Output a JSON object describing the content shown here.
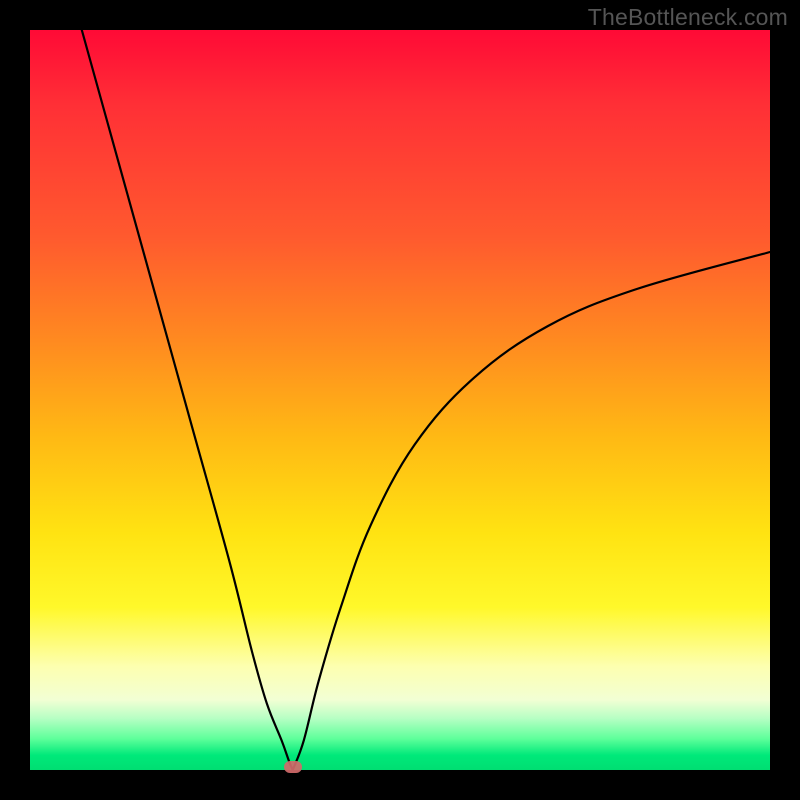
{
  "watermark": "TheBottleneck.com",
  "colors": {
    "curve": "#000000",
    "vertex": "#d16a6a",
    "frame": "#000000"
  },
  "chart_data": {
    "type": "line",
    "title": "",
    "xlabel": "",
    "ylabel": "",
    "xlim": [
      0,
      100
    ],
    "ylim": [
      0,
      100
    ],
    "grid": false,
    "legend": false,
    "series": [
      {
        "name": "left-branch",
        "x": [
          7,
          12,
          17,
          22,
          27,
          30,
          32,
          34,
          35,
          35.5
        ],
        "y": [
          100,
          82,
          64,
          46,
          28,
          16,
          9,
          4,
          1.2,
          0
        ]
      },
      {
        "name": "right-branch",
        "x": [
          35.5,
          37,
          39,
          42,
          46,
          52,
          60,
          70,
          82,
          100
        ],
        "y": [
          0,
          4,
          12,
          22,
          33,
          44,
          53,
          60,
          65,
          70
        ]
      }
    ],
    "vertex": {
      "x": 35.5,
      "y": 0
    },
    "background_gradient_stops": [
      {
        "pct": 0,
        "color": "#ff0a36"
      },
      {
        "pct": 28,
        "color": "#ff5a2e"
      },
      {
        "pct": 55,
        "color": "#ffb914"
      },
      {
        "pct": 78,
        "color": "#fff82a"
      },
      {
        "pct": 90.5,
        "color": "#f2ffd4"
      },
      {
        "pct": 100,
        "color": "#00de72"
      }
    ]
  }
}
